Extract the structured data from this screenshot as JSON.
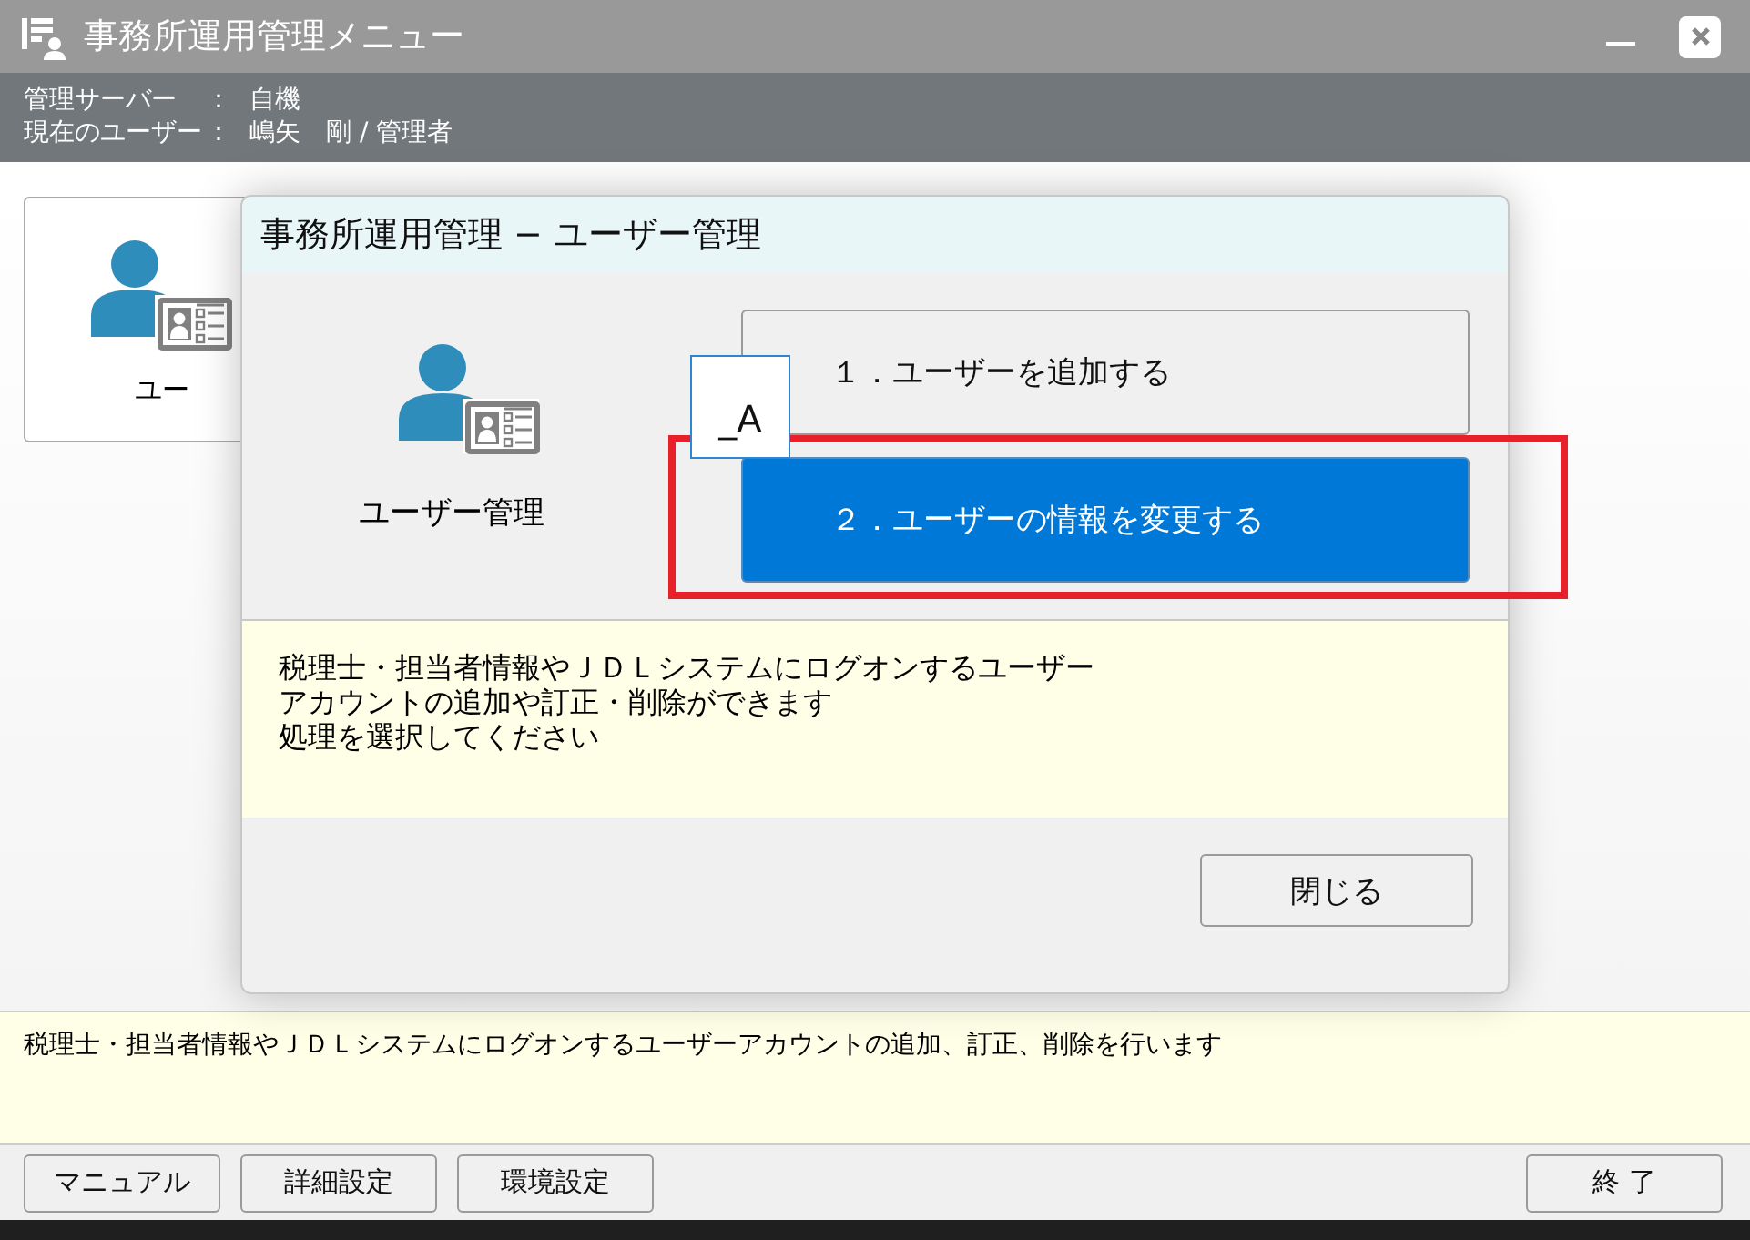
{
  "window": {
    "title": "事務所運用管理メニュー"
  },
  "info": [
    {
      "label": "管理サーバー",
      "separator": "：",
      "value": "自機"
    },
    {
      "label": "現在のユーザー",
      "separator": "：",
      "value": "嶋矢　剛 / 管理者"
    }
  ],
  "menu_card": {
    "label": "ユー"
  },
  "dialog": {
    "title": "事務所運用管理 − ユーザー管理",
    "label": "ユーザー管理",
    "options": [
      {
        "label": "１．ユーザーを追加する",
        "selected": false
      },
      {
        "label": "２．ユーザーの情報を変更する",
        "selected": true
      }
    ],
    "ime_indicator": "_A",
    "description": [
      "税理士・担当者情報やＪＤＬシステムにログオンするユーザー",
      "アカウントの追加や訂正・削除ができます",
      "処理を選択してください"
    ],
    "close_button": "閉じる"
  },
  "status_text": "税理士・担当者情報やＪＤＬシステムにログオンするユーザーアカウントの追加、訂正、削除を行います",
  "buttons": [
    {
      "label": "マニュアル"
    },
    {
      "label": "詳細設定"
    },
    {
      "label": "環境設定"
    }
  ],
  "exit_button": "終 了"
}
